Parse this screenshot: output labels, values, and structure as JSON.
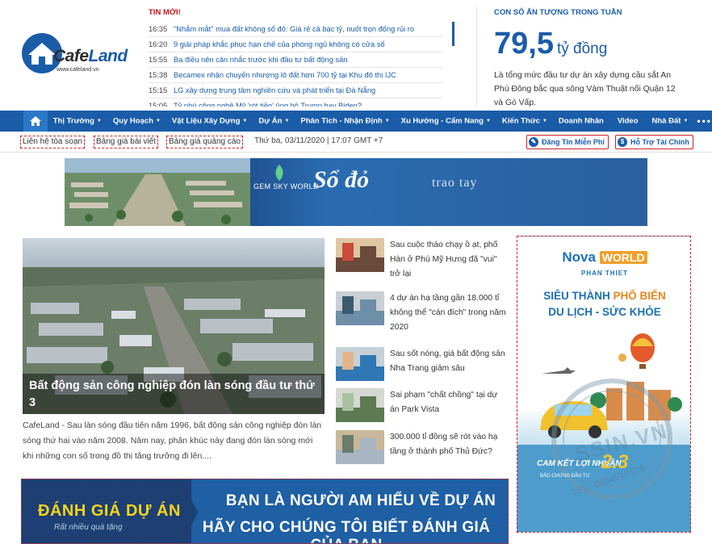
{
  "brand": {
    "logo_word_a": "Cafe",
    "logo_word_b": "Land",
    "logo_url": "www.cafeland.vn"
  },
  "news": {
    "title": "TIN MỚI!",
    "items": [
      {
        "time": "16:35",
        "headline": "\"Nhắm mắt\" mua đất không sổ đỏ: Giá rẻ cả bạc tỷ, nuốt trọn đống rủi ro"
      },
      {
        "time": "16:20",
        "headline": "9 giải pháp khắc phục hạn chế của phòng ngủ không có cửa sổ"
      },
      {
        "time": "15:55",
        "headline": "Ba điều nên cân nhắc trước khi đầu tư bất động sản"
      },
      {
        "time": "15:38",
        "headline": "Becamex nhận chuyển nhượng lô đất hơn 700 tỷ tại Khu đô thị IJC"
      },
      {
        "time": "15:15",
        "headline": "LG xây dựng trung tâm nghiên cứu và phát triển tại Đà Nẵng"
      },
      {
        "time": "15:05",
        "headline": "Tỷ phú công nghệ Mỹ 'rót tiền' ủng hộ Trump hay Biden?"
      }
    ]
  },
  "impress": {
    "title": "CON SỐ ẤN TƯỢNG TRONG TUẦN",
    "number": "79,5",
    "unit": "tỷ đồng",
    "desc": "Là tổng mức đầu tư dự án xây dựng cầu sắt An Phú Đông bắc qua sông Vàm Thuật nối Quận 12 và Gò Vấp."
  },
  "nav": {
    "items": [
      {
        "label": "Thị Trường",
        "caret": "▼"
      },
      {
        "label": "Quy Hoạch",
        "caret": "▼"
      },
      {
        "label": "Vật Liệu Xây Dựng",
        "caret": "▼"
      },
      {
        "label": "Dự Án",
        "caret": "▼"
      },
      {
        "label": "Phân Tích - Nhận Định",
        "caret": "▼"
      },
      {
        "label": "Xu Hướng - Cẩm Nang",
        "caret": "▼"
      },
      {
        "label": "Kiến Thức",
        "caret": "▼"
      },
      {
        "label": "Doanh Nhân",
        "caret": ""
      },
      {
        "label": "Video",
        "caret": ""
      },
      {
        "label": "Nhà Đất",
        "caret": "▼"
      }
    ],
    "more": "•••"
  },
  "subbar": {
    "contact": "Liên hệ tòa soạn",
    "price_article": "Bảng giá bài viết",
    "price_ads": "Bảng giá quảng cáo",
    "date": "Thứ ba, 03/11/2020 | 17:07 GMT +7",
    "post_free": "Đăng Tin Miễn Phí",
    "support": "Hỗ Trợ Tài Chính"
  },
  "banner": {
    "brand": "GEM SKY WORLD",
    "headline": "Sổ đỏ",
    "tagline": "trao tay"
  },
  "lead": {
    "title": "Bất động sản công nghiệp đón làn sóng đầu tư thứ 3",
    "desc": "CafeLand - Sau làn sóng đầu tiên năm 1996, bất động sản công nghiệp đón làn sóng thứ hai vào năm 2008. Năm nay, phân khúc này đang đón làn sóng mới khi những con số trong đồ thị tăng trưởng đi lên...."
  },
  "side": [
    {
      "title": "Sau cuộc tháo chạy ồ ạt, phố Hàn ở Phú Mỹ Hưng đã \"vui\" trở lại"
    },
    {
      "title": "4 dự án hạ tầng gần 18.000 tỉ không thể \"cán đích\" trong năm 2020"
    },
    {
      "title": "Sau sốt nóng, giá bất động sản Nha Trang giảm sâu"
    },
    {
      "title": "Sai phạm \"chất chồng\" tại dự án Park Vista"
    },
    {
      "title": "300.000 tỉ đồng sẽ rót vào hạ tầng ở thành phố Thủ Đức?"
    }
  ],
  "bottom_ad": {
    "left_title": "ĐÁNH GIÁ DỰ ÁN",
    "left_sub": "Rất nhiều quà tặng",
    "line1": "BẠN LÀ NGƯỜI AM HIỂU VỀ DỰ ÁN",
    "line2": "HÃY CHO CHÚNG TÔI BIẾT ĐÁNH GIÁ CỦA BẠN"
  },
  "right_ad": {
    "brand_a": "Nova",
    "brand_b": "WORLD",
    "place": "PHAN THIET",
    "h1_a": "SIÊU THÀNH ",
    "h1_b": "PHỐ BIỂN",
    "h2": "DU LỊCH - SỨC KHỎE",
    "cam": "CAM KẾT LỢI NHUẬN",
    "pct": "2.3",
    "sub": "BẢO CHỨNG ĐẦU TƯ",
    "stamp": "SSIN.VN",
    "phone": "TEL: 0934519516"
  },
  "colors": {
    "primary": "#1a5ca8",
    "accent": "#c4141c",
    "yellow": "#f5d31e"
  }
}
